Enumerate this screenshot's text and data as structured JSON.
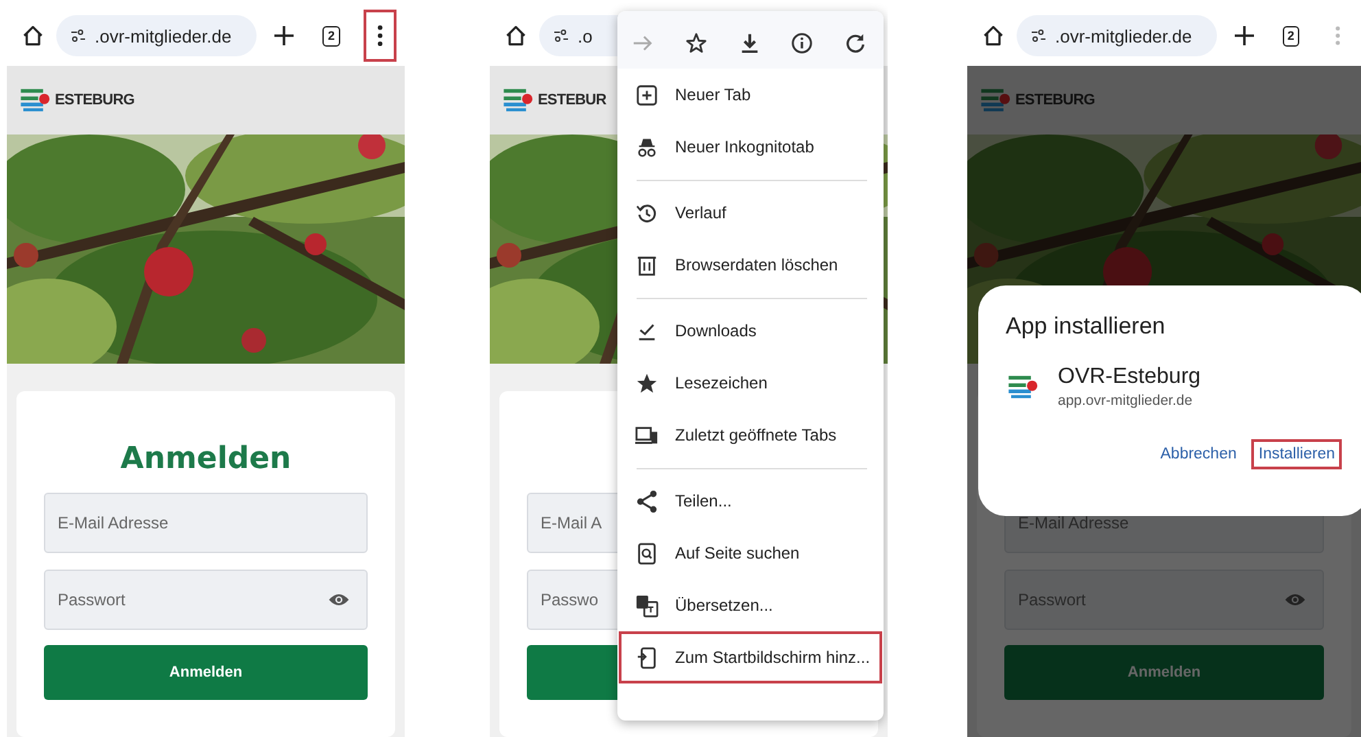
{
  "panels": [
    {
      "kind": "page",
      "toolbar": {
        "url": ".ovr-mitglieder.de",
        "tab_count": "2",
        "menu_highlighted": true,
        "menu_dimmed": false
      },
      "page": {
        "brand": "ESTEBURG",
        "heading": "Anmelden",
        "email_placeholder": "E-Mail Adresse",
        "password_placeholder": "Passwort",
        "password_toggle": true,
        "submit": "Anmelden"
      }
    },
    {
      "kind": "menu",
      "toolbar": {
        "url": ".o"
      },
      "page": {
        "brand": "ESTEBUR",
        "email_placeholder": "E-Mail A",
        "password_placeholder": "Passwo"
      },
      "menu": {
        "forward_enabled": false,
        "groups": [
          [
            {
              "label": "Neuer Tab",
              "highlighted": false
            },
            {
              "label": "Neuer Inkognitotab",
              "highlighted": false
            }
          ],
          [
            {
              "label": "Verlauf",
              "highlighted": false
            },
            {
              "label": "Browserdaten löschen",
              "highlighted": false
            }
          ],
          [
            {
              "label": "Downloads",
              "highlighted": false
            },
            {
              "label": "Lesezeichen",
              "highlighted": false
            },
            {
              "label": "Zuletzt geöffnete Tabs",
              "highlighted": false
            }
          ],
          [
            {
              "label": "Teilen...",
              "highlighted": false
            },
            {
              "label": "Auf Seite suchen",
              "highlighted": false
            },
            {
              "label": "Übersetzen...",
              "highlighted": false
            },
            {
              "label": "Zum Startbildschirm hinz...",
              "highlighted": true
            }
          ]
        ]
      }
    },
    {
      "kind": "dialog",
      "toolbar": {
        "url": ".ovr-mitglieder.de",
        "tab_count": "2",
        "menu_highlighted": false,
        "menu_dimmed": true
      },
      "page": {
        "brand": "ESTEBURG",
        "email_placeholder": "E-Mail Adresse",
        "password_placeholder": "Passwort",
        "password_toggle": true,
        "submit": "Anmelden"
      },
      "dialog": {
        "title": "App installieren",
        "app_name": "OVR-Esteburg",
        "app_url": "app.ovr-mitglieder.de",
        "buttons": [
          {
            "label": "Abbrechen",
            "highlighted": false
          },
          {
            "label": "Installieren",
            "highlighted": true
          }
        ]
      }
    }
  ]
}
